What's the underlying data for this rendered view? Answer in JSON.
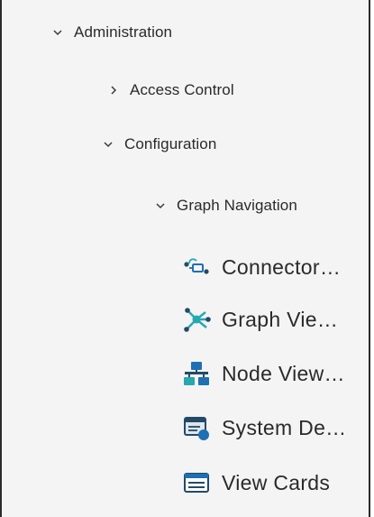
{
  "tree": {
    "administration": {
      "label": "Administration",
      "icon": "chevron-down-icon"
    },
    "access_control": {
      "label": "Access Control",
      "icon": "chevron-right-icon"
    },
    "configuration": {
      "label": "Configuration",
      "icon": "chevron-down-icon"
    },
    "graph_navigation": {
      "label": "Graph Navigation",
      "icon": "chevron-down-icon"
    },
    "leaves": [
      {
        "label": "Connector…",
        "icon": "connector-icon"
      },
      {
        "label": "Graph Vie…",
        "icon": "graph-view-icon"
      },
      {
        "label": "Node View…",
        "icon": "node-view-icon"
      },
      {
        "label": "System De…",
        "icon": "system-definition-icon"
      },
      {
        "label": "View Cards",
        "icon": "view-cards-icon"
      }
    ]
  },
  "colors": {
    "panel_background": "#f4f4f4",
    "text": "#2a2a2a",
    "icon_blue": "#1f6fb3",
    "icon_teal": "#27a7b0",
    "icon_dark": "#234a66"
  }
}
